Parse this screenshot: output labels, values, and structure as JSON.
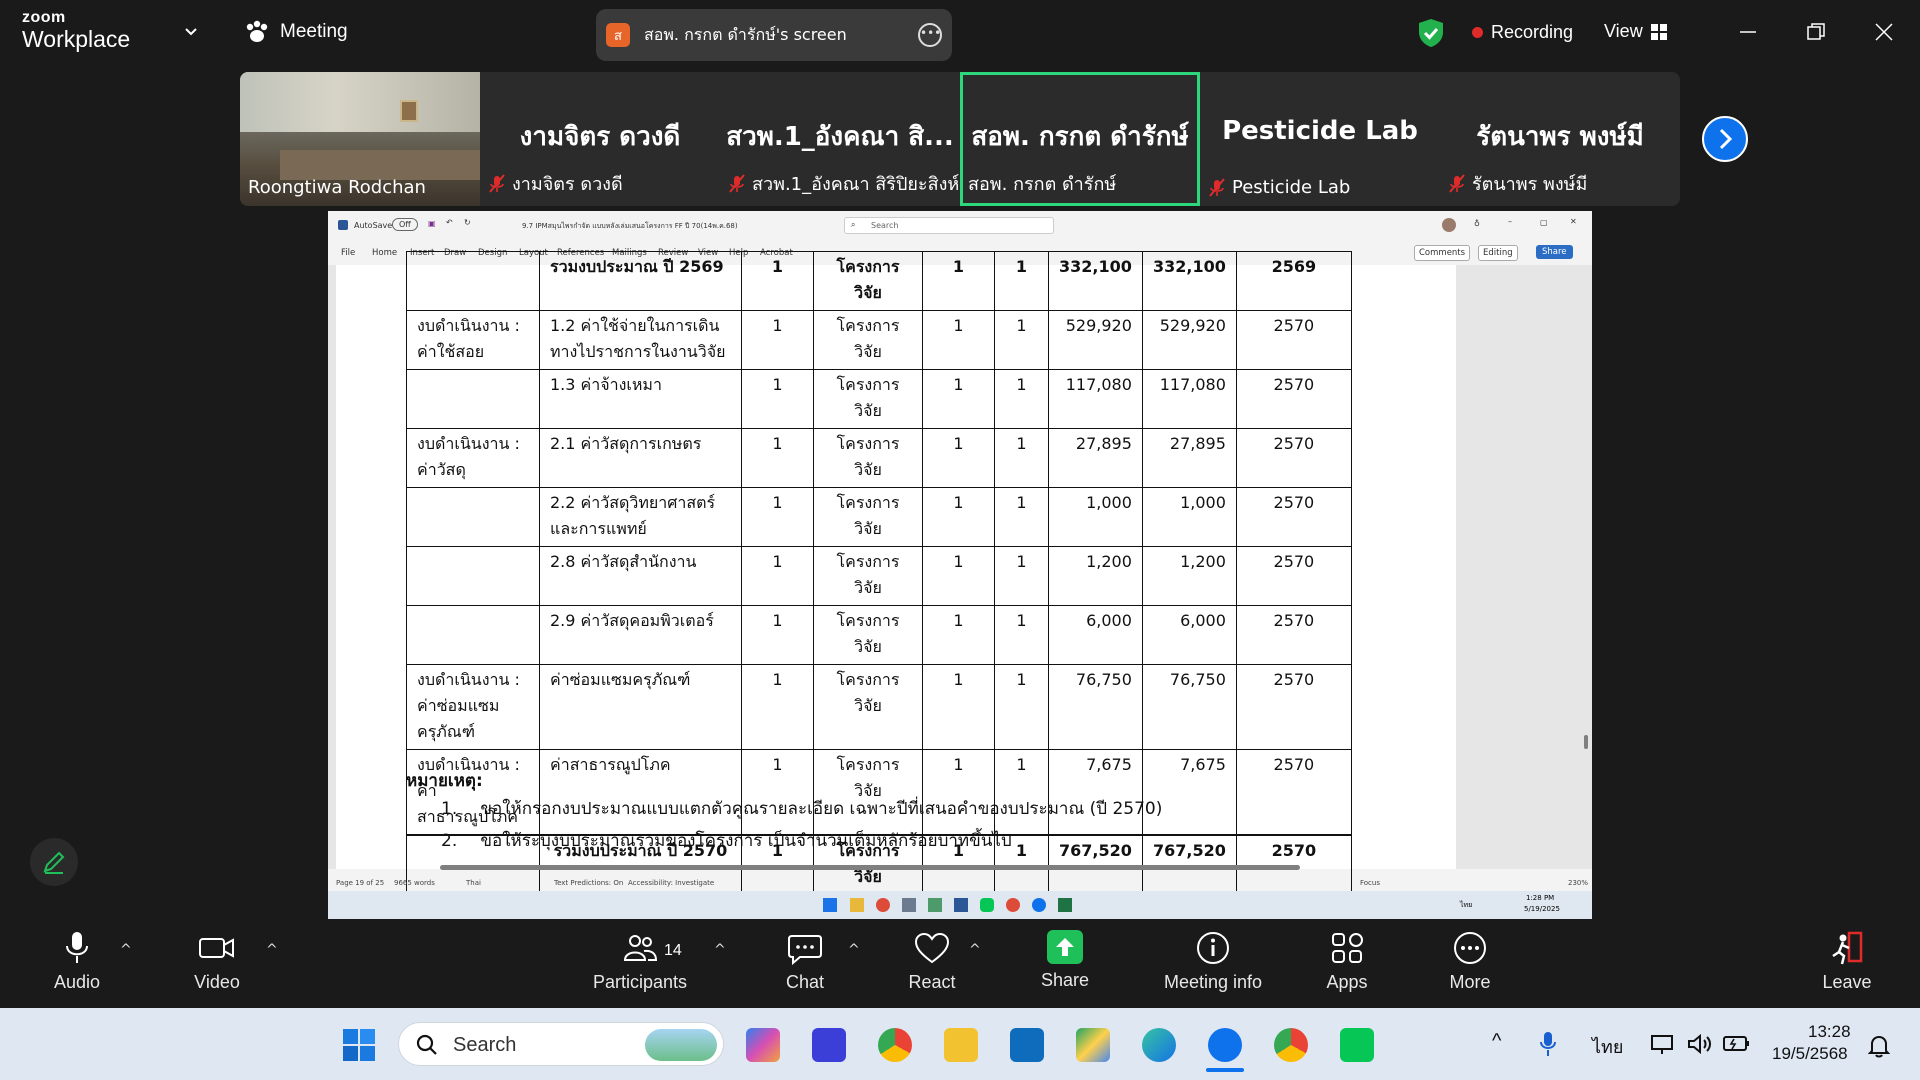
{
  "app": {
    "brand_line1": "zoom",
    "brand_line2": "Workplace"
  },
  "topbar": {
    "meeting_label": "Meeting",
    "share_initial": "ส",
    "share_title": "สอพ. กรกต ดำรักษ์'s screen",
    "recording_label": "Recording",
    "view_label": "View"
  },
  "participants": [
    {
      "big": "",
      "name": "Roongtiwa Rodchan",
      "muted": false,
      "video": true
    },
    {
      "big": "งามจิตร ดวงดี",
      "name": "งามจิตร ดวงดี",
      "muted": true
    },
    {
      "big": "สวพ.1_อังคณา สิ...",
      "name": "สวพ.1_อังคณา สิริปิยะสิงห์",
      "muted": true
    },
    {
      "big": "สอพ. กรกต ดำรักษ์",
      "name": "สอพ. กรกต ดำรักษ์",
      "muted": false,
      "active": true
    },
    {
      "big": "Pesticide Lab",
      "name": "Pesticide Lab",
      "muted": true
    },
    {
      "big": "รัตนาพร พงษ์มี",
      "name": "รัตนาพร พงษ์มี",
      "muted": true
    }
  ],
  "word": {
    "autosave": "AutoSave",
    "autosave_state": "Off",
    "doc_title": "9.7 IPMสมุนไพรกำจัด แบบหลังเล่มเสนอโครงการ FF ปี 70(14พ.ค.68)",
    "search_placeholder": "Search",
    "menu": [
      "File",
      "Home",
      "Insert",
      "Draw",
      "Design",
      "Layout",
      "References",
      "Mailings",
      "Review",
      "View",
      "Help",
      "Acrobat"
    ],
    "comments_label": "Comments",
    "editing_label": "Editing",
    "share_label": "Share",
    "status_page": "Page 19 of 25",
    "status_words": "9665 words",
    "status_lang": "Thai",
    "status_predictions": "Text Predictions: On",
    "status_accessibility": "Accessibility: Investigate",
    "status_focus": "Focus",
    "status_zoom": "230%",
    "inner_clock_time": "1:28 PM",
    "inner_clock_date": "5/19/2025",
    "inner_lang": "ไทย"
  },
  "budget_table": {
    "partial_top_row": [
      "",
      "รวมงบประมาณ ปี 2569",
      "1",
      "โครงการวิจัย",
      "1",
      "1",
      "332,100",
      "332,100",
      "2569"
    ],
    "rows": [
      {
        "cat": "งบดำเนินงาน : ค่าใช้สอย",
        "item": "1.2 ค่าใช้จ่ายในการเดินทางไปราชการในงานวิจัย",
        "qty": "1",
        "unit": "โครงการวิจัย",
        "n1": "1",
        "n2": "1",
        "price": "529,920",
        "total": "529,920",
        "year": "2570"
      },
      {
        "cat": "",
        "item": "1.3 ค่าจ้างเหมา",
        "qty": "1",
        "unit": "โครงการวิจัย",
        "n1": "1",
        "n2": "1",
        "price": "117,080",
        "total": "117,080",
        "year": "2570"
      },
      {
        "cat": "งบดำเนินงาน : ค่าวัสดุ",
        "item": "2.1 ค่าวัสดุการเกษตร",
        "qty": "1",
        "unit": "โครงการวิจัย",
        "n1": "1",
        "n2": "1",
        "price": "27,895",
        "total": "27,895",
        "year": "2570"
      },
      {
        "cat": "",
        "item": "2.2 ค่าวัสดุวิทยาศาสตร์และการแพทย์",
        "qty": "1",
        "unit": "โครงการวิจัย",
        "n1": "1",
        "n2": "1",
        "price": "1,000",
        "total": "1,000",
        "year": "2570"
      },
      {
        "cat": "",
        "item": "2.8 ค่าวัสดุสำนักงาน",
        "qty": "1",
        "unit": "โครงการวิจัย",
        "n1": "1",
        "n2": "1",
        "price": "1,200",
        "total": "1,200",
        "year": "2570"
      },
      {
        "cat": "",
        "item": "2.9 ค่าวัสดุคอมพิวเตอร์",
        "qty": "1",
        "unit": "โครงการวิจัย",
        "n1": "1",
        "n2": "1",
        "price": "6,000",
        "total": "6,000",
        "year": "2570"
      },
      {
        "cat": "งบดำเนินงาน : ค่าซ่อมแซมครุภัณฑ์",
        "item": "ค่าซ่อมแซมครุภัณฑ์",
        "qty": "1",
        "unit": "โครงการวิจัย",
        "n1": "1",
        "n2": "1",
        "price": "76,750",
        "total": "76,750",
        "year": "2570"
      },
      {
        "cat": "งบดำเนินงาน : ค่าสาธารณูปโภค",
        "item": "ค่าสาธารณูปโภค",
        "qty": "1",
        "unit": "โครงการวิจัย",
        "n1": "1",
        "n2": "1",
        "price": "7,675",
        "total": "7,675",
        "year": "2570"
      }
    ],
    "total_row": {
      "cat": "",
      "item": "รวมงบประมาณ ปี 2570",
      "qty": "1",
      "unit": "โครงการวิจัย",
      "n1": "1",
      "n2": "1",
      "price": "767,520",
      "total": "767,520",
      "year": "2570"
    }
  },
  "notes": {
    "title": "หมายเหตุ:",
    "items": [
      {
        "num": "1.",
        "text": "ขอให้กรอกงบประมาณแบบแตกตัวคูณรายละเอียด เฉพาะปีที่เสนอคำของบประมาณ (ปี 2570)"
      },
      {
        "num": "2.",
        "text": "ขอให้ระบุงบประมาณรวมของโครงการ เป็นจำนวนเต็มหลักร้อยบาทขึ้นไป"
      }
    ]
  },
  "toolbar": {
    "audio": "Audio",
    "video": "Video",
    "participants": "Participants",
    "participants_count": "14",
    "chat": "Chat",
    "react": "React",
    "share": "Share",
    "meeting_info": "Meeting info",
    "apps": "Apps",
    "more": "More",
    "leave": "Leave"
  },
  "taskbar": {
    "search_label": "Search",
    "lang": "ไทย",
    "time": "13:28",
    "date": "19/5/2568"
  },
  "colors": {
    "zoom_blue": "#0e72ed",
    "active_green": "#2ed67c",
    "share_green": "#1fbf59",
    "recording_red": "#e02b2b",
    "muted_red": "#e02b2b"
  }
}
